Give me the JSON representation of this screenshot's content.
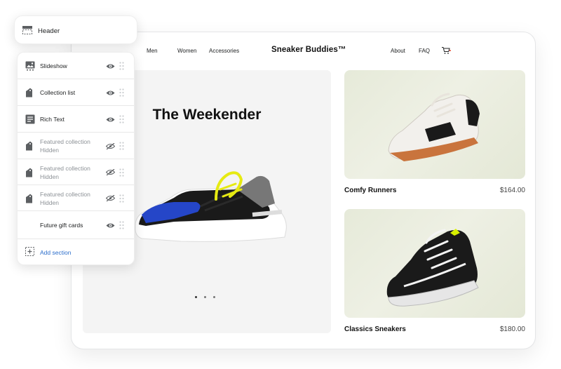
{
  "store": {
    "nav": {
      "men": "Men",
      "women": "Women",
      "accessories": "Accessories",
      "about": "About",
      "faq": "FAQ"
    },
    "brand": "Sneaker Buddies™",
    "hero": {
      "title": "The Weekender",
      "slide_count": 3,
      "active_slide": 1
    },
    "products": [
      {
        "name": "Comfy Runners",
        "price": "$164.00"
      },
      {
        "name": "Classics Sneakers",
        "price": "$180.00"
      }
    ]
  },
  "sidebar": {
    "header_label": "Header",
    "sections": [
      {
        "label": "Slideshow",
        "sub": "",
        "visible": true,
        "icon": "slideshow-icon"
      },
      {
        "label": "Collection list",
        "sub": "",
        "visible": true,
        "icon": "collection-icon"
      },
      {
        "label": "Rich Text",
        "sub": "",
        "visible": true,
        "icon": "text-icon"
      },
      {
        "label": "Featured collection",
        "sub": "Hidden",
        "visible": false,
        "icon": "collection-icon"
      },
      {
        "label": "Featured collection",
        "sub": "Hidden",
        "visible": false,
        "icon": "collection-icon"
      },
      {
        "label": "Featured collection",
        "sub": "Hidden",
        "visible": false,
        "icon": "collection-icon"
      },
      {
        "label": "Future gift cards",
        "sub": "",
        "visible": true,
        "icon": ""
      }
    ],
    "add_section_label": "Add section"
  },
  "colors": {
    "accent_link": "#2c6ecb",
    "hero_bg": "#f4f4f4",
    "product_bg": "#e8ecdb"
  }
}
